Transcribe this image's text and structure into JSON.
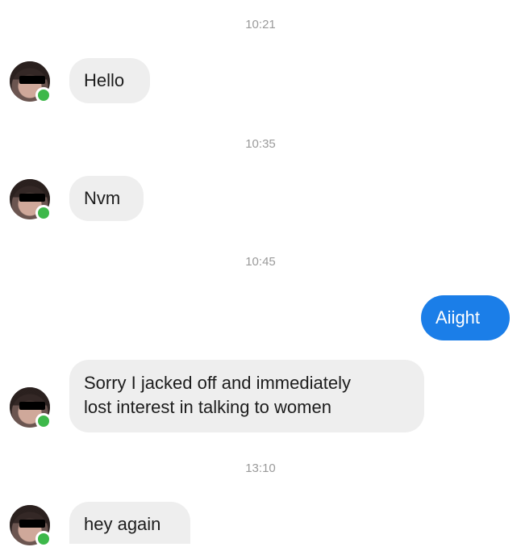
{
  "messages": [
    {
      "timestamp": "10:21",
      "text": "Hello"
    },
    {
      "timestamp": "10:35",
      "text": "Nvm"
    },
    {
      "timestamp": "10:45",
      "text": "Aiight"
    },
    {
      "text_line1": "Sorry I jacked off and immediately",
      "text_line2": "lost interest in talking to women"
    },
    {
      "timestamp": "13:10",
      "text": "hey again"
    }
  ],
  "colors": {
    "incoming_bubble": "#eeeeee",
    "outgoing_bubble": "#1b7ee8",
    "online_dot": "#3db84a",
    "timestamp": "#9a9a9a"
  },
  "icons": {
    "avatar": "profile-photo-censored",
    "status": "online-dot"
  }
}
